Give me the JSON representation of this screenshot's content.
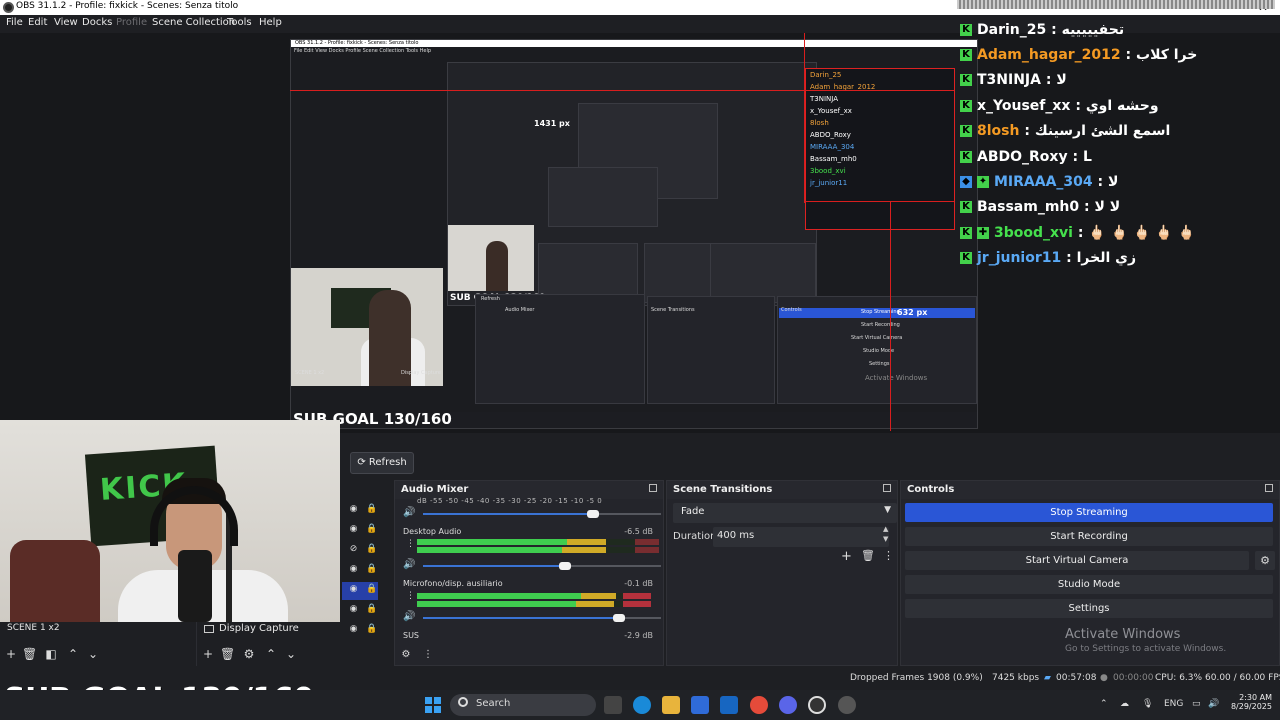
{
  "window": {
    "title": "OBS 31.1.2 - Profile: fixkick - Scenes: Senza titolo",
    "close": "✕"
  },
  "menu": [
    "File",
    "Edit",
    "View",
    "Docks",
    "Profile",
    "Scene Collection",
    "Tools",
    "Help"
  ],
  "preview": {
    "nested_title": "OBS 31.1.2 - Profile: fixkick - Scenes: Senza titolo",
    "nested_menu": "File   Edit   View   Docks   Profile   Scene Collection   Tools   Help",
    "px_label_1": "1431 px",
    "px_label_2": "632 px",
    "sub_goal_small": "SUB GOAL 130/160",
    "sub_goal_mid": "SUB GOAL 130/160",
    "nested_refresh": "Refresh",
    "nested_audio": "Audio Mixer",
    "nested_transitions": "Scene Transitions",
    "nested_controls": "Controls",
    "nested_stop": "Stop Streaming",
    "nested_start_rec": "Start Recording",
    "nested_start_vcam": "Start Virtual Camera",
    "nested_studio": "Studio Mode",
    "nested_settings": "Settings",
    "nested_activate": "Activate Windows",
    "nested_scene": "SCENE 1 x2",
    "nested_source": "Display Capture"
  },
  "chat": {
    "brand_color": "#43d14b",
    "lines": [
      {
        "name": "Darin_25",
        "msg": " : تحفيييييه",
        "color": "#ffffff"
      },
      {
        "name": "Adam_hagar_2012",
        "msg": " : خرا كلاب",
        "color": "#f49a23"
      },
      {
        "name": "T3NINJA",
        "msg": " : لا",
        "color": "#ffffff"
      },
      {
        "name": "x_Yousef_xx",
        "msg": " : وحشه اوي",
        "color": "#ffffff"
      },
      {
        "name": "8losh",
        "msg": " : اسمع الشئ ارسينك",
        "color": "#f49a23"
      },
      {
        "name": "ABDO_Roxy",
        "msg": " : L",
        "color": "#ffffff"
      },
      {
        "name": "MIRAAA_304",
        "msg": " : لا",
        "color": "#5aa9f5"
      },
      {
        "name": "Bassam_mh0",
        "msg": " : لا لا",
        "color": "#ffffff"
      },
      {
        "name": "3bood_xvi",
        "msg": " : 🖕🏻 🖕🏻 🖕🏻 🖕🏻 🖕🏻",
        "color": "#45e04d"
      },
      {
        "name": "jr_junior11",
        "msg": " : زي الخرا",
        "color": "#5aa9f5"
      }
    ]
  },
  "webcam": {
    "flag_text": "KICK"
  },
  "scenes": {
    "item": "SCENE 1 x2"
  },
  "sources": {
    "item": "Display Capture"
  },
  "refresh_label": "Refresh",
  "audio_mixer": {
    "title": "Audio Mixer",
    "scale": "dB  -55  -50  -45  -40  -35  -30  -25  -20  -15  -10  -5   0",
    "channels": [
      {
        "name": "",
        "db": "",
        "level": 0.0,
        "volume": 0.85
      },
      {
        "name": "Desktop Audio",
        "db": "-6.5 dB",
        "level": 0.82,
        "volume": 0.71
      },
      {
        "name": "Microfono/disp. ausiliario",
        "db": "-0.1 dB",
        "level": 0.95,
        "volume": 0.98
      },
      {
        "name": "SUS",
        "db": "-2.9 dB",
        "level": 0.0,
        "volume": 0.0
      }
    ]
  },
  "transitions": {
    "title": "Scene Transitions",
    "selected": "Fade",
    "duration_label": "Duration",
    "duration_value": "400 ms"
  },
  "controls": {
    "title": "Controls",
    "stop_streaming": "Stop Streaming",
    "start_recording": "Start Recording",
    "start_virtual_camera": "Start Virtual Camera",
    "studio_mode": "Studio Mode",
    "settings": "Settings",
    "activate_title": "Activate Windows",
    "activate_sub": "Go to Settings to activate Windows.",
    "primary_color": "#2a56d6"
  },
  "status": {
    "dropped": "Dropped Frames 1908 (0.9%)",
    "bitrate": "7425 kbps",
    "stream_time": "00:57:08",
    "rec_time": "00:00:00",
    "cpu": "CPU: 6.3%",
    "fps": "60.00 / 60.00 FPS"
  },
  "overlay": {
    "sub_goal": "SUB GOAL 130/160"
  },
  "taskbar": {
    "search": "Search",
    "lang": "ENG",
    "time": "2:30 AM",
    "date": "8/29/2025"
  }
}
